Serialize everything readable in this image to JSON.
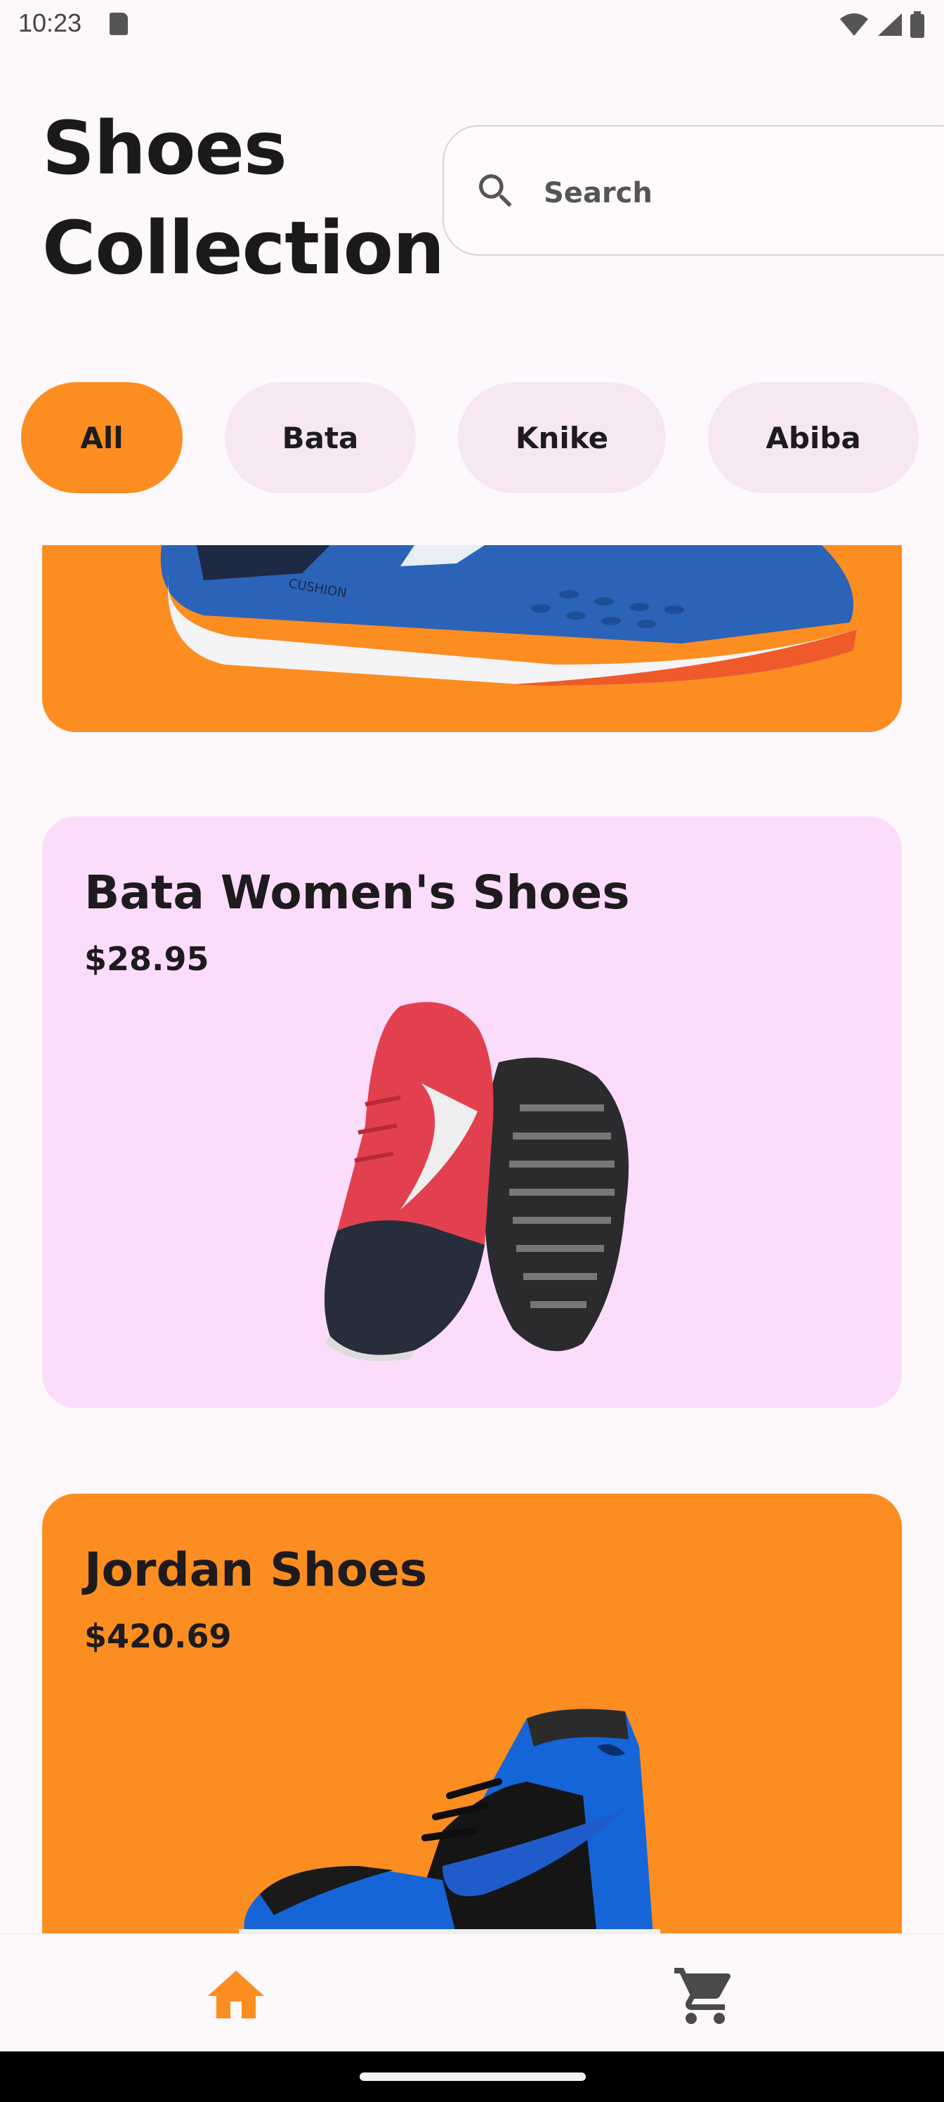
{
  "status_bar": {
    "time": "10:23"
  },
  "header": {
    "title_line1": "Shoes",
    "title_line2": "Collection",
    "search_placeholder": "Search"
  },
  "filters": [
    "All",
    "Bata",
    "Knike",
    "Abiba"
  ],
  "active_filter": "All",
  "products": [
    {
      "name": "Bata Women's Shoes",
      "price": "$28.95",
      "card_color": "#fcdcfb"
    },
    {
      "name": "Jordan Shoes",
      "price": "$420.69",
      "card_color": "#fc8d21"
    }
  ],
  "partial_card_color": "#fc8d21",
  "accent_color": "#fc8d21",
  "bottom_nav": [
    {
      "icon": "home-icon",
      "active": true
    },
    {
      "icon": "cart-icon",
      "active": false
    }
  ]
}
